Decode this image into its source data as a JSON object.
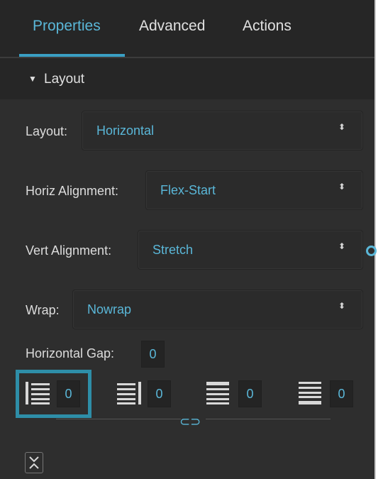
{
  "tabs": [
    {
      "label": "Properties",
      "active": true
    },
    {
      "label": "Advanced",
      "active": false
    },
    {
      "label": "Actions",
      "active": false
    }
  ],
  "section": {
    "arrow": "▼",
    "title": "Layout"
  },
  "fields": {
    "layout": {
      "label": "Layout:",
      "value": "Horizontal"
    },
    "horiz_alignment": {
      "label": "Horiz Alignment:",
      "value": "Flex-Start"
    },
    "vert_alignment": {
      "label": "Vert Alignment:",
      "value": "Stretch"
    },
    "wrap": {
      "label": "Wrap:",
      "value": "Nowrap"
    },
    "horizontal_gap": {
      "label": "Horizontal Gap:",
      "value": "0"
    }
  },
  "padding": {
    "left": "0",
    "right": "0",
    "top": "0",
    "bottom": "0"
  },
  "select_caret": "⬍",
  "link_icon": "⊂⊃",
  "colors": {
    "accent": "#5ab7d8",
    "highlight": "#2e8ea8",
    "panel": "#2e2e2e"
  }
}
